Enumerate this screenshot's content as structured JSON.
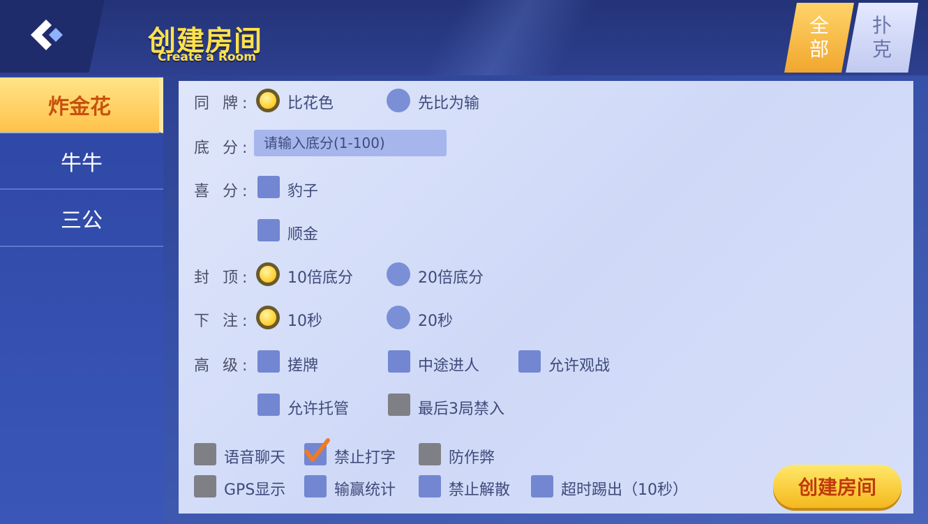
{
  "header": {
    "title": "创建房间",
    "subtitle": "Create a Room",
    "back_icon": "back-arrow-icon",
    "tabs": [
      {
        "line1": "全",
        "line2": "部",
        "active": true
      },
      {
        "line1": "扑",
        "line2": "克",
        "active": false
      }
    ]
  },
  "sidebar": {
    "items": [
      {
        "label": "炸金花",
        "active": true
      },
      {
        "label": "牛牛",
        "active": false
      },
      {
        "label": "三公",
        "active": false
      }
    ]
  },
  "form": {
    "same_cards": {
      "label": "同 牌:",
      "options": [
        "比花色",
        "先比为输"
      ],
      "selected": 0
    },
    "base_score": {
      "label": "底 分:",
      "placeholder": "请输入底分(1-100)"
    },
    "bonus": {
      "label": "喜 分:",
      "options": [
        "豹子",
        "顺金"
      ]
    },
    "cap": {
      "label": "封 顶:",
      "options": [
        "10倍底分",
        "20倍底分"
      ],
      "selected": 0
    },
    "bet": {
      "label": "下 注:",
      "options": [
        "10秒",
        "20秒"
      ],
      "selected": 0
    },
    "advanced": {
      "label": "高 级:",
      "options": [
        "搓牌",
        "中途进人",
        "允许观战",
        "允许托管",
        "最后3局禁入"
      ]
    },
    "extras": [
      "语音聊天",
      "禁止打字",
      "防作弊",
      "GPS显示",
      "输赢统计",
      "禁止解散",
      "超时踢出（10秒）"
    ],
    "extras_checked": [
      false,
      true,
      false,
      false,
      false,
      false,
      false
    ]
  },
  "create_button": "创建房间",
  "colors": {
    "accent": "#ffe24a",
    "button_text": "#c03a0a",
    "active_tab": "#c8510d"
  }
}
